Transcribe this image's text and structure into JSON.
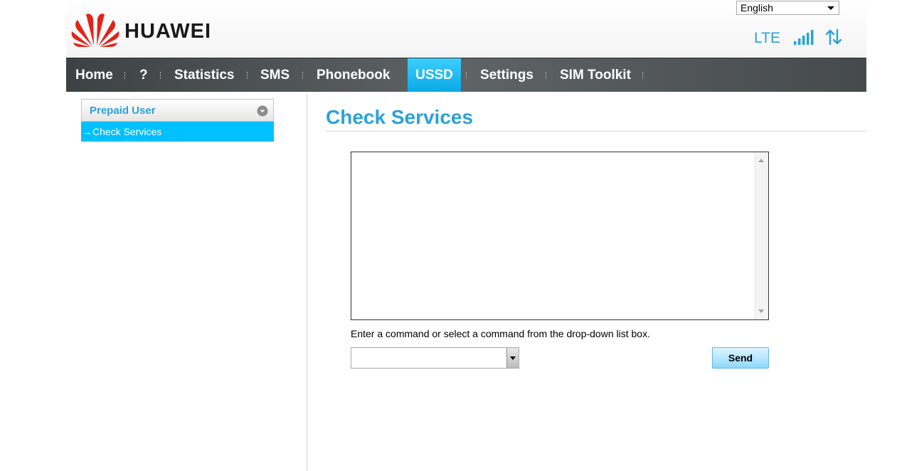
{
  "header": {
    "brand": "HUAWEI",
    "language": "English",
    "network_type": "LTE",
    "signal_bars": 5,
    "colors": {
      "brand_red": "#e2231a",
      "accent": "#2aa2d8"
    },
    "icons": [
      "huawei-logo",
      "signal-strength-icon",
      "data-transfer-icon"
    ]
  },
  "nav": {
    "items": [
      {
        "label": "Home",
        "active": false
      },
      {
        "label": "?",
        "active": false
      },
      {
        "label": "Statistics",
        "active": false
      },
      {
        "label": "SMS",
        "active": false
      },
      {
        "label": "Phonebook",
        "active": false
      },
      {
        "label": "USSD",
        "active": true
      },
      {
        "label": "Settings",
        "active": false
      },
      {
        "label": "SIM Toolkit",
        "active": false
      }
    ],
    "colors": {
      "bar": "#4a4f51",
      "active": "#00bfff"
    }
  },
  "sidebar": {
    "header": "Prepaid User",
    "items": [
      {
        "label": "→Check Services",
        "selected": true
      }
    ]
  },
  "main": {
    "title": "Check Services",
    "hint": "Enter a command or select a command from the drop-down list box.",
    "command_value": "",
    "send_label": "Send"
  }
}
